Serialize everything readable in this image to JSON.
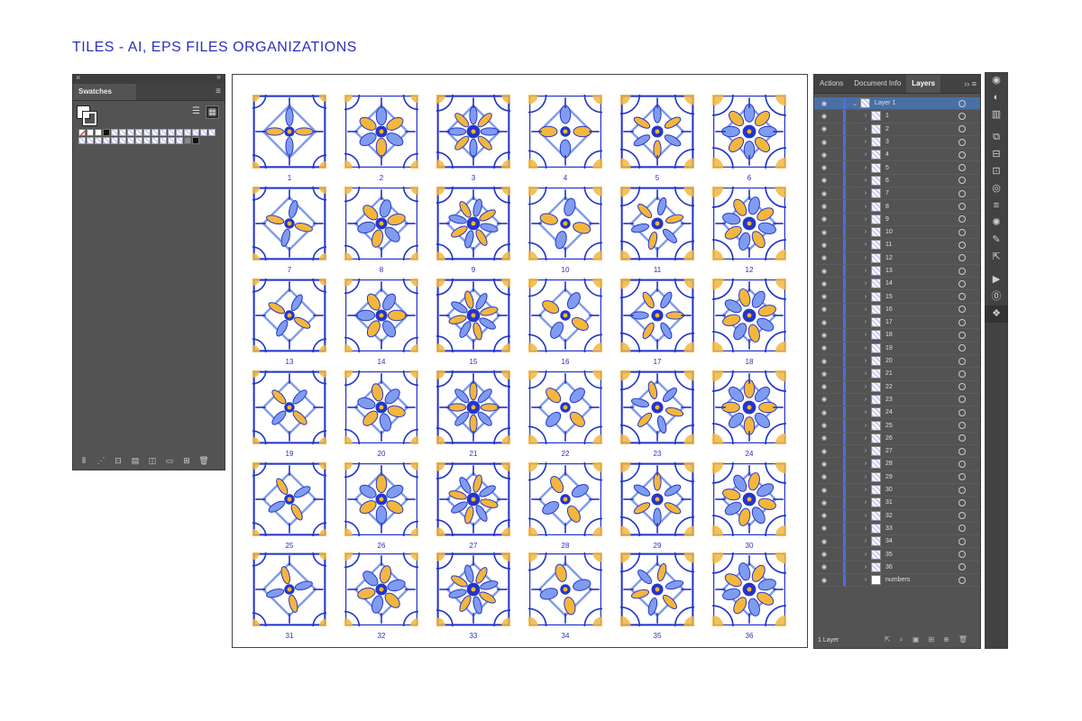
{
  "page_title": "TILES - AI, EPS FILES ORGANIZATIONS",
  "swatches_panel": {
    "tab_label": "Swatches",
    "close_glyph": "×",
    "collapse_glyph": "»",
    "menu_icon": "menu-icon",
    "pattern_swatch_count": 26,
    "bottom_icons": [
      "swatch-libraries-icon",
      "show-kinds-icon",
      "swatch-options-icon",
      "color-group-icon",
      "edit-color-icon",
      "new-group-icon",
      "new-swatch-icon",
      "delete-icon"
    ]
  },
  "canvas": {
    "tile_numbers": [
      "1",
      "2",
      "3",
      "4",
      "5",
      "6",
      "7",
      "8",
      "9",
      "10",
      "11",
      "12",
      "13",
      "14",
      "15",
      "16",
      "17",
      "18",
      "19",
      "20",
      "21",
      "22",
      "23",
      "24",
      "25",
      "26",
      "27",
      "28",
      "29",
      "30",
      "31",
      "32",
      "33",
      "34",
      "35",
      "36"
    ],
    "colors": {
      "blue": "#2436c8",
      "light_blue": "#7f9cf0",
      "yellow": "#f4b63c",
      "number": "#2a2fc0"
    }
  },
  "layers_panel": {
    "tabs": [
      "Actions",
      "Document Info",
      "Layers"
    ],
    "active_tab": "Layers",
    "top_layer": "Layer 1",
    "sublayers": [
      "1",
      "2",
      "3",
      "4",
      "5",
      "6",
      "7",
      "8",
      "9",
      "10",
      "11",
      "12",
      "13",
      "14",
      "15",
      "16",
      "17",
      "18",
      "19",
      "20",
      "21",
      "22",
      "23",
      "24",
      "25",
      "26",
      "27",
      "28",
      "29",
      "30",
      "31",
      "32",
      "33",
      "34",
      "35",
      "36"
    ],
    "last_sublayer": "numbers",
    "footer_label": "1 Layer"
  },
  "dock_icons": [
    "appearance-icon",
    "color-icon",
    "gradient-icon",
    "transform-icon",
    "align-icon",
    "pathfinder-icon",
    "transparency-icon",
    "stroke-icon",
    "symbols-icon",
    "brushes-icon",
    "export-icon",
    "play-icon",
    "links-icon",
    "layers-icon"
  ]
}
